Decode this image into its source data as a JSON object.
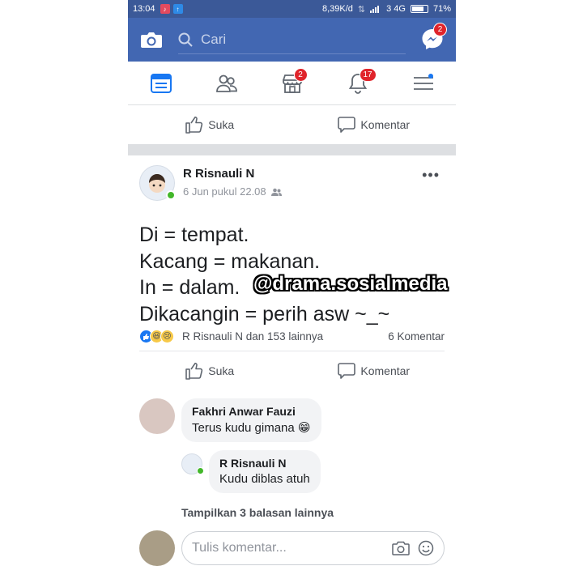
{
  "status_bar": {
    "time": "13:04",
    "speed": "8,39K/d",
    "network": "3 4G",
    "battery": "71%"
  },
  "top_bar": {
    "search_placeholder": "Cari",
    "messenger_badge": "2"
  },
  "nav": {
    "marketplace_badge": "2",
    "notifications_badge": "17"
  },
  "top_actions": {
    "like": "Suka",
    "comment": "Komentar"
  },
  "post": {
    "author": "R Risnauli N",
    "time": "6 Jun pukul 22.08",
    "lines": [
      "Di = tempat.",
      "Kacang = makanan.",
      "In = dalam.",
      "Dikacangin = perih asw ~_~"
    ],
    "watermark": "@drama.sosialmedia",
    "reactions_text": "R Risnauli N dan 153 lainnya",
    "comments_count": "6 Komentar",
    "like": "Suka",
    "comment": "Komentar"
  },
  "comments": [
    {
      "name": "Fakhri Anwar Fauzi",
      "text": "Terus kudu gimana 😁"
    }
  ],
  "reply": {
    "name": "R Risnauli N",
    "text": "Kudu diblas atuh"
  },
  "more_replies": "Tampilkan 3 balasan lainnya",
  "composer": {
    "placeholder": "Tulis komentar..."
  },
  "colors": {
    "brand": "#4267b2",
    "badge": "#e0242b",
    "online": "#42b72a"
  }
}
